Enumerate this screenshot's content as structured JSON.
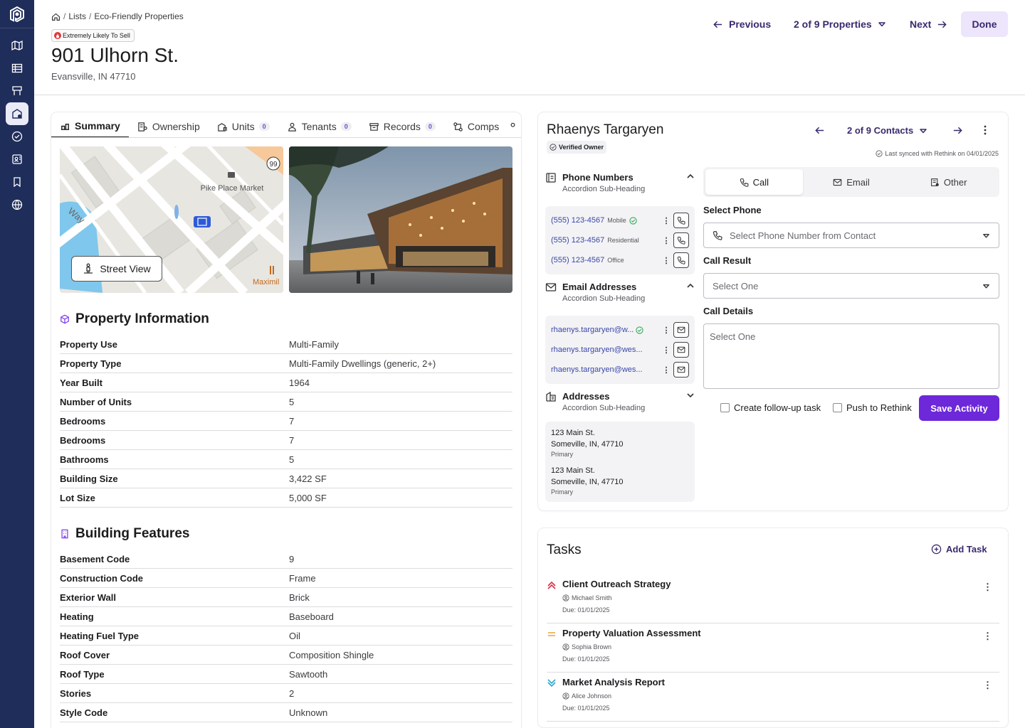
{
  "breadcrumb": {
    "home_icon": "home-icon",
    "items": [
      "Lists",
      "Eco-Friendly Properties"
    ]
  },
  "badge": {
    "label": "Extremely Likely To Sell",
    "color": "#e23a3a"
  },
  "property": {
    "title": "901 Ulhorn St.",
    "location": "Evansville, IN 47710"
  },
  "nav": {
    "previous": "Previous",
    "position": "2 of 9 Properties",
    "next": "Next",
    "done": "Done"
  },
  "tabs": [
    {
      "label": "Summary",
      "count": null,
      "icon": "summary-icon"
    },
    {
      "label": "Ownership",
      "count": null,
      "icon": "ownership-icon"
    },
    {
      "label": "Units",
      "count": "0",
      "icon": "units-icon"
    },
    {
      "label": "Tenants",
      "count": "0",
      "icon": "tenants-icon"
    },
    {
      "label": "Records",
      "count": "0",
      "icon": "records-icon"
    },
    {
      "label": "Comps",
      "count": null,
      "icon": "comps-icon"
    }
  ],
  "map": {
    "place": "Pike Place Market",
    "street": "Way",
    "poi": "Maximil",
    "route": "99",
    "street_view": "Street View"
  },
  "property_info": {
    "title": "Property Information",
    "rows": [
      {
        "k": "Property Use",
        "v": "Multi-Family"
      },
      {
        "k": "Property Type",
        "v": "Multi-Family Dwellings (generic, 2+)"
      },
      {
        "k": "Year Built",
        "v": "1964"
      },
      {
        "k": "Number of Units",
        "v": "5"
      },
      {
        "k": "Bedrooms",
        "v": "7"
      },
      {
        "k": "Bedrooms",
        "v": "7"
      },
      {
        "k": "Bathrooms",
        "v": "5"
      },
      {
        "k": "Building Size",
        "v": "3,422 SF"
      },
      {
        "k": "Lot Size",
        "v": "5,000 SF"
      }
    ]
  },
  "building_features": {
    "title": "Building Features",
    "rows": [
      {
        "k": "Basement Code",
        "v": "9"
      },
      {
        "k": "Construction Code",
        "v": "Frame"
      },
      {
        "k": "Exterior Wall",
        "v": "Brick"
      },
      {
        "k": "Heating",
        "v": "Baseboard"
      },
      {
        "k": "Heating Fuel Type",
        "v": "Oil"
      },
      {
        "k": "Roof Cover",
        "v": "Composition Shingle"
      },
      {
        "k": "Roof Type",
        "v": "Sawtooth"
      },
      {
        "k": "Stories",
        "v": "2"
      },
      {
        "k": "Style Code",
        "v": "Unknown"
      }
    ]
  },
  "contact": {
    "name": "Rhaenys Targaryen",
    "verified": "Verified Owner",
    "position": "2 of 9 Contacts",
    "synced": "Last synced with Rethink on 04/01/2025",
    "phones": {
      "title": "Phone Numbers",
      "subtitle": "Accordion Sub-Heading",
      "items": [
        {
          "number": "(555) 123-4567",
          "type": "Mobile"
        },
        {
          "number": "(555) 123-4567",
          "type": "Residential"
        },
        {
          "number": "(555) 123-4567",
          "type": "Office"
        }
      ]
    },
    "emails": {
      "title": "Email Addresses",
      "subtitle": "Accordion Sub-Heading",
      "items": [
        "rhaenys.targaryen@w...",
        "rhaenys.targaryen@wes...",
        "rhaenys.targaryen@wes..."
      ]
    },
    "addresses": {
      "title": "Addresses",
      "subtitle": "Accordion Sub-Heading",
      "items": [
        {
          "line1": "123 Main St.",
          "line2": "Someville, IN, 47710",
          "tag": "Primary"
        },
        {
          "line1": "123 Main St.",
          "line2": "Someville, IN, 47710",
          "tag": "Primary"
        }
      ]
    }
  },
  "activity": {
    "tabs": [
      "Call",
      "Email",
      "Other"
    ],
    "select_phone_label": "Select Phone",
    "select_phone_placeholder": "Select Phone Number from Contact",
    "call_result_label": "Call Result",
    "call_result_placeholder": "Select One",
    "call_details_label": "Call Details",
    "call_details_placeholder": "Select One",
    "followup": "Create follow-up task",
    "push": "Push to Rethink",
    "save": "Save Activity",
    "accent": "#6d28d9"
  },
  "tasks": {
    "title": "Tasks",
    "add": "Add Task",
    "items": [
      {
        "title": "Client Outreach Strategy",
        "assignee": "Michael Smith",
        "due": "Due: 01/01/2025",
        "priority": "high"
      },
      {
        "title": "Property Valuation Assessment",
        "assignee": "Sophia Brown",
        "due": "Due: 01/01/2025",
        "priority": "medium"
      },
      {
        "title": "Market Analysis Report",
        "assignee": "Alice Johnson",
        "due": "Due: 01/01/2025",
        "priority": "low"
      }
    ]
  }
}
